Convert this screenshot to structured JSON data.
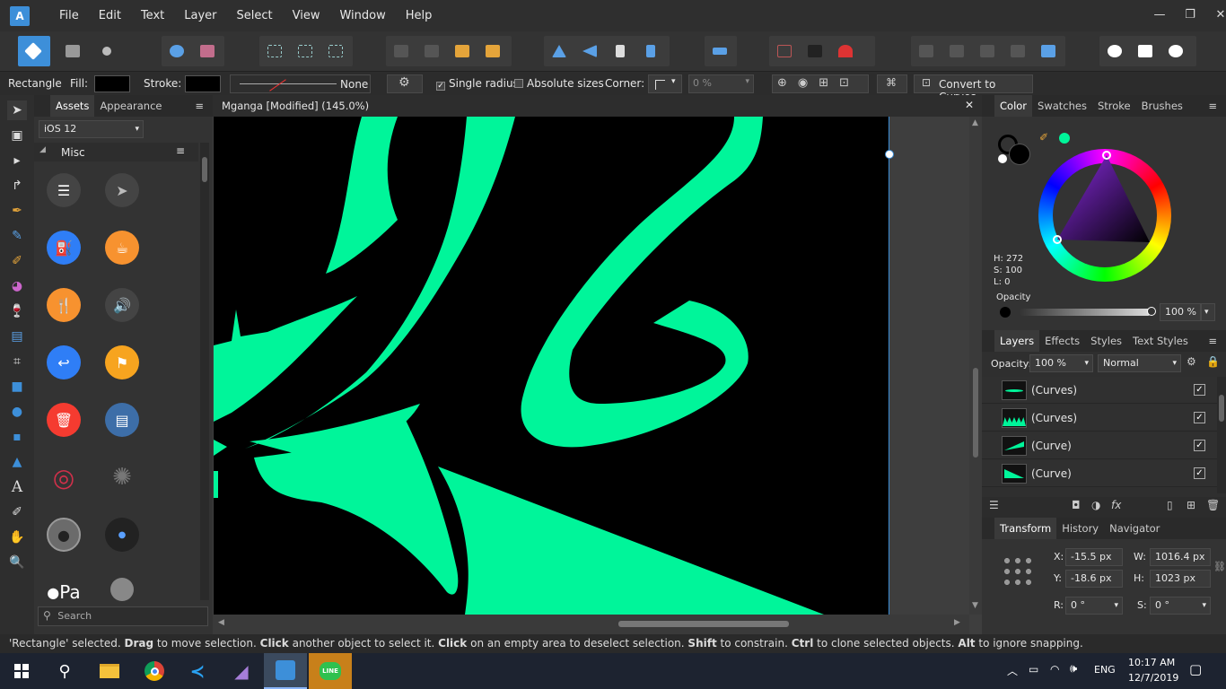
{
  "menu": {
    "items": [
      "File",
      "Edit",
      "Text",
      "Layer",
      "Select",
      "View",
      "Window",
      "Help"
    ]
  },
  "window_controls": {
    "minimize": "—",
    "restore": "❐",
    "close": "✕"
  },
  "context_bar": {
    "tool_name": "Rectangle",
    "fill_label": "Fill:",
    "stroke_label": "Stroke:",
    "stroke_style": "None",
    "single_radius": "Single radius",
    "absolute_sizes": "Absolute sizes",
    "corner_label": "Corner:",
    "corner_value": "0 %",
    "convert_button": "Convert to Curves"
  },
  "assets_panel": {
    "tabs": [
      "Assets",
      "Appearance"
    ],
    "category": "iOS 12",
    "section": "Misc",
    "search_placeholder": "Search",
    "apple_pay_text": "Pa"
  },
  "document": {
    "title": "Mganga [Modified] (145.0%)"
  },
  "color_panel": {
    "tabs": [
      "Color",
      "Swatches",
      "Stroke",
      "Brushes"
    ],
    "h": "H: 272",
    "s": "S: 100",
    "l": "L: 0",
    "opacity_label": "Opacity",
    "opacity_value": "100 %"
  },
  "layers_panel": {
    "tabs": [
      "Layers",
      "Effects",
      "Styles",
      "Text Styles"
    ],
    "opacity_label": "Opacity:",
    "opacity_value": "100 %",
    "blend_mode": "Normal",
    "layers": [
      "(Curves)",
      "(Curves)",
      "(Curve)",
      "(Curve)"
    ]
  },
  "transform_panel": {
    "tabs": [
      "Transform",
      "History",
      "Navigator"
    ],
    "x_label": "X:",
    "x": "-15.5 px",
    "y_label": "Y:",
    "y": "-18.6 px",
    "w_label": "W:",
    "w": "1016.4 px",
    "h_label": "H:",
    "h": "1023 px",
    "r_label": "R:",
    "r": "0 °",
    "s_label": "S:",
    "s": "0 °"
  },
  "status": {
    "p1": "'Rectangle' selected. ",
    "b1": "Drag",
    "p2": " to move selection. ",
    "b2": "Click",
    "p3": " another object to select it. ",
    "b3": "Click",
    "p4": " on an empty area to deselect selection. ",
    "b4": "Shift",
    "p5": " to constrain. ",
    "b5": "Ctrl",
    "p6": " to clone selected objects. ",
    "b6": "Alt",
    "p7": " to ignore snapping."
  },
  "taskbar": {
    "language": "ENG",
    "time": "10:17 AM",
    "date": "12/7/2019",
    "line_label": "LINE"
  },
  "colors": {
    "accent_green": "#00f59a",
    "canvas_bg": "#000000",
    "panel_bg": "#333333"
  }
}
